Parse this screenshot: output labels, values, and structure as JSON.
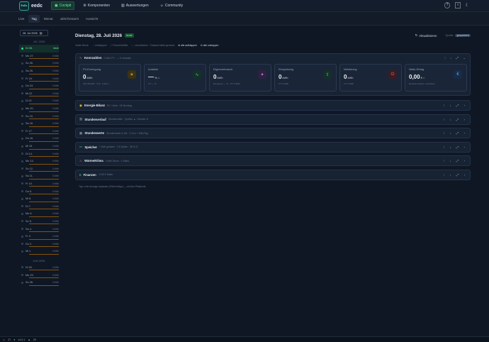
{
  "app": {
    "logo": "EnDc",
    "name": "eedc"
  },
  "nav": [
    {
      "label": "Cockpit",
      "icon": "grid-icon",
      "glyph": "▣",
      "active": true
    },
    {
      "label": "Komponenten",
      "icon": "component-icon",
      "glyph": "⚙",
      "active": false
    },
    {
      "label": "Auswertungen",
      "icon": "chart-icon",
      "glyph": "▥",
      "active": false
    },
    {
      "label": "Community",
      "icon": "people-icon",
      "glyph": "☺",
      "active": false
    }
  ],
  "topright": {
    "help": "?",
    "info": "i",
    "theme": "☾"
  },
  "subnav": [
    {
      "label": "Live",
      "active": false
    },
    {
      "label": "Tag",
      "active": true
    },
    {
      "label": "Monat",
      "active": false
    },
    {
      "label": "Jahr/Gesamt",
      "active": false
    },
    {
      "label": "Aussicht",
      "active": false
    }
  ],
  "sidebar": {
    "date_value": "28. Jul 2026",
    "months": [
      {
        "label": "JUL 2026",
        "days": [
          {
            "label": "Di 28.",
            "val": "heute",
            "today": true
          },
          {
            "label": "Mo 27.",
            "val": "0 kWh"
          },
          {
            "label": "So 26.",
            "val": "0 kWh"
          },
          {
            "label": "Sa 25.",
            "val": "0 kWh"
          },
          {
            "label": "Fr 24.",
            "val": "0 kWh"
          },
          {
            "label": "Do 23.",
            "val": "0 kWh"
          },
          {
            "label": "Mi 22.",
            "val": "0 kWh"
          },
          {
            "label": "Di 21.",
            "val": "0 kWh"
          },
          {
            "label": "Mo 20.",
            "val": "0 kWh"
          },
          {
            "label": "So 19.",
            "val": "0 kWh"
          },
          {
            "label": "Sa 18.",
            "val": "0 kWh"
          },
          {
            "label": "Fr 17.",
            "val": "0 kWh"
          },
          {
            "label": "Do 16.",
            "val": "0 kWh"
          },
          {
            "label": "Mi 15.",
            "val": "0 kWh"
          },
          {
            "label": "Di 14.",
            "val": "0 kWh"
          },
          {
            "label": "Mo 13.",
            "val": "0 kWh"
          },
          {
            "label": "So 12.",
            "val": "0 kWh"
          },
          {
            "label": "Sa 11.",
            "val": "0 kWh"
          },
          {
            "label": "Fr 10.",
            "val": "0 kWh"
          },
          {
            "label": "Do 9.",
            "val": "0 kWh"
          },
          {
            "label": "Mi 8.",
            "val": "0 kWh"
          },
          {
            "label": "Di 7.",
            "val": "0 kWh"
          },
          {
            "label": "Mo 6.",
            "val": "0 kWh"
          },
          {
            "label": "So 5.",
            "val": "0 kWh"
          },
          {
            "label": "Sa 4.",
            "val": "0 kWh"
          },
          {
            "label": "Fr 3.",
            "val": "0 kWh"
          },
          {
            "label": "Do 2.",
            "val": "0 kWh"
          },
          {
            "label": "Mi 1.",
            "val": "0 kWh"
          }
        ]
      },
      {
        "label": "JUN 2026",
        "days": [
          {
            "label": "Di 30.",
            "val": "0 kWh"
          },
          {
            "label": "Mo 29.",
            "val": "0 kWh"
          },
          {
            "label": "So 28.",
            "val": "0 kWh"
          }
        ]
      }
    ]
  },
  "main": {
    "title": "Dienstag, 28. Juli 2026",
    "today_badge": "heute",
    "refresh_label": "Aktualisieren",
    "source_label": "Quelle:",
    "source_value": "gespeichert",
    "hints": [
      "Jeden Block:",
      "einklappen",
      "Fokus/Vollbild",
      "verschieben · Zustand bleibt gemerkt",
      "alle aufklappen",
      "alle zuklappen"
    ],
    "kpi": {
      "title": "Kennzahlen",
      "sub": "0 kWh PV · — % Autarkie",
      "cards": [
        {
          "label": "PV-Erzeugung",
          "value": "0",
          "unit": "kWh",
          "foot": "370,38 kWh · 0 % · 0,00 k…",
          "icon": "sun-icon",
          "glyph": "☀",
          "color": "#facc15",
          "bg": "#3a3215"
        },
        {
          "label": "Autarkie",
          "value": "—",
          "unit": "% ○",
          "foot": "VT — %",
          "icon": "activity-icon",
          "glyph": "∿",
          "color": "#4ade80",
          "bg": "#14302a"
        },
        {
          "label": "Eigenverbrauch",
          "value": "0",
          "unit": "kWh",
          "foot": "EV-Quote — % · VT: 0 kWh",
          "icon": "bolt-icon",
          "glyph": "✦",
          "color": "#c084fc",
          "bg": "#2e2140"
        },
        {
          "label": "Einspeisung",
          "value": "0",
          "unit": "kWh",
          "foot": "VT: 0 kWh",
          "icon": "upload-icon",
          "glyph": "⇧",
          "color": "#4ade80",
          "bg": "#14302a"
        },
        {
          "label": "Netzbezug",
          "value": "0",
          "unit": "kWh",
          "foot": "VT: 0 kWh",
          "icon": "plug-icon",
          "glyph": "⏻",
          "color": "#f87171",
          "bg": "#3a1c22"
        },
        {
          "label": "Netto-Ertrag",
          "value": "0,00",
          "unit": "€ ○",
          "foot": "Einspeise-Erlös + EV-Ersp…",
          "icon": "euro-icon",
          "glyph": "€",
          "color": "#60a5fa",
          "bg": "#182c48"
        }
      ]
    },
    "sections": [
      {
        "title": "Energie-Bilanz",
        "sub": "EV / Verbr. / Ø Dienstag",
        "icon": "balance-icon",
        "glyph": "◉",
        "color": "#facc15"
      },
      {
        "title": "Stundenverlauf",
        "sub": "Stundenmittel · Quellen ▲ / Senken ▼",
        "icon": "hourly-icon",
        "glyph": "▥",
        "color": "#94a3b8"
      },
      {
        "title": "Stundenwerte",
        "sub": "Stundenwerte in kW · Σ 24-h + kWh/Tag",
        "icon": "table-icon",
        "glyph": "▦",
        "color": "#94a3b8"
      },
      {
        "title": "Speicher",
        "sub": "7 kWh geladen · 0,5 Zyklen · 38 % ∅",
        "icon": "battery-icon",
        "glyph": "▭",
        "color": "#4ade80"
      },
      {
        "title": "Wärme/Klima",
        "sub": "0 kWh Strom · 1 Starts",
        "icon": "flame-icon",
        "glyph": "♨",
        "color": "#f87171"
      },
      {
        "title": "Finanzen",
        "sub": "+0,00 € Saldo",
        "icon": "finance-icon",
        "glyph": "€",
        "color": "#4ade80"
      }
    ],
    "footnote": "Tipp: eine Anzeige anpassen (Reihenfolge) — auf den Pfeilpunkt."
  },
  "status": {
    "counter": "37",
    "version": "v4.0.1",
    "badge": "25"
  }
}
